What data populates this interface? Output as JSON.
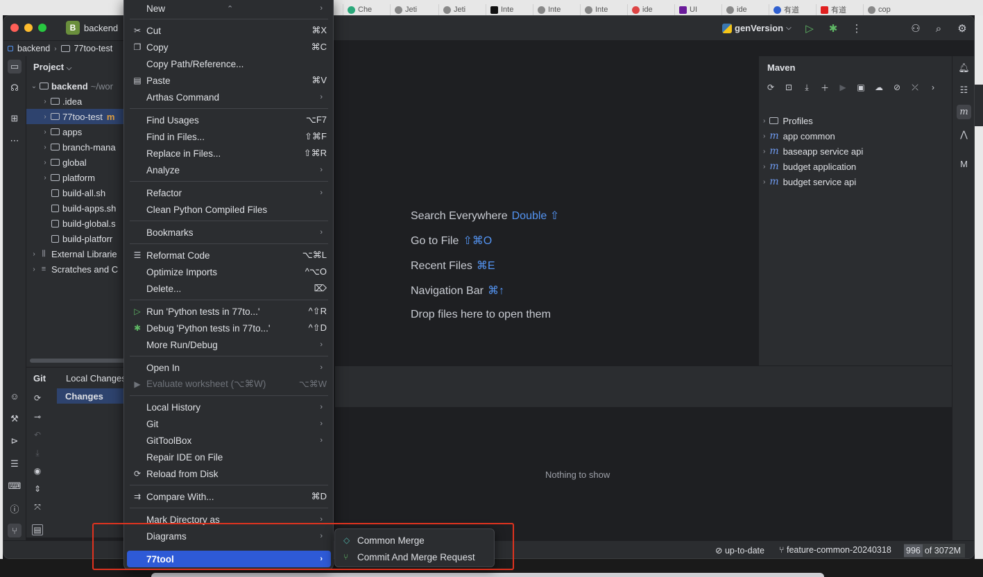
{
  "browser_tabs": [
    "Che",
    "Jeti",
    "Jeti",
    "Inte",
    "Inte",
    "Inte",
    "ide",
    "UI",
    "ide",
    "有道",
    "有道",
    "cop"
  ],
  "window": {
    "project_badge": "B",
    "project_name": "backend",
    "run_config": "genVersion"
  },
  "breadcrumb": {
    "root": "backend",
    "child": "77too-test"
  },
  "project_panel": {
    "title": "Project",
    "root_label": "backend",
    "root_path": "~/wor",
    "items": [
      ".idea",
      "77too-test",
      "apps",
      "branch-mana",
      "global",
      "platform",
      "build-all.sh",
      "build-apps.sh",
      "build-global.s",
      "build-platforr"
    ],
    "selected_suffix": "m",
    "external_libraries": "External Librarie",
    "scratches": "Scratches and C"
  },
  "git_panel": {
    "tab_git": "Git",
    "tab_local_changes": "Local Changes",
    "changes_node": "Changes"
  },
  "editor": {
    "hints": [
      {
        "text": "Search Everywhere",
        "key": "Double ⇧"
      },
      {
        "text": "Go to File",
        "key": "⇧⌘O"
      },
      {
        "text": "Recent Files",
        "key": "⌘E"
      },
      {
        "text": "Navigation Bar",
        "key": "⌘↑"
      },
      {
        "text": "Drop files here to open them",
        "key": ""
      }
    ]
  },
  "maven": {
    "title": "Maven",
    "profiles": "Profiles",
    "modules": [
      "app common",
      "baseapp service api",
      "budget application",
      "budget service api"
    ]
  },
  "bottom_panel": {
    "empty_text": "Nothing to show"
  },
  "statusbar": {
    "vcs_status": "up-to-date",
    "branch": "feature-common-20240318",
    "memory_used": "996",
    "memory_total": "of 3072M"
  },
  "context_menu": {
    "new": "New",
    "cut": {
      "label": "Cut",
      "shortcut": "⌘X"
    },
    "copy": {
      "label": "Copy",
      "shortcut": "⌘C"
    },
    "copy_path": "Copy Path/Reference...",
    "paste": {
      "label": "Paste",
      "shortcut": "⌘V"
    },
    "arthas": "Arthas Command",
    "find_usages": {
      "label": "Find Usages",
      "shortcut": "⌥F7"
    },
    "find_in_files": {
      "label": "Find in Files...",
      "shortcut": "⇧⌘F"
    },
    "replace_in_files": {
      "label": "Replace in Files...",
      "shortcut": "⇧⌘R"
    },
    "analyze": "Analyze",
    "refactor": "Refactor",
    "clean_python": "Clean Python Compiled Files",
    "bookmarks": "Bookmarks",
    "reformat": {
      "label": "Reformat Code",
      "shortcut": "⌥⌘L"
    },
    "optimize": {
      "label": "Optimize Imports",
      "shortcut": "^⌥O"
    },
    "delete": {
      "label": "Delete...",
      "shortcut": "⌦"
    },
    "run_tests": {
      "label": "Run 'Python tests in 77to...'",
      "shortcut": "^⇧R"
    },
    "debug_tests": {
      "label": "Debug 'Python tests in 77to...'",
      "shortcut": "^⇧D"
    },
    "more_run": "More Run/Debug",
    "open_in": "Open In",
    "evaluate": {
      "label": "Evaluate worksheet (⌥⌘W)",
      "shortcut": "⌥⌘W"
    },
    "local_history": "Local History",
    "git": "Git",
    "gittoolbox": "GitToolBox",
    "repair": "Repair IDE on File",
    "reload": "Reload from Disk",
    "compare": {
      "label": "Compare With...",
      "shortcut": "⌘D"
    },
    "mark_directory": "Mark Directory as",
    "diagrams": "Diagrams",
    "tool77": "77tool"
  },
  "submenu": {
    "common_merge": "Common Merge",
    "commit_merge": "Commit And Merge Request"
  },
  "colors": {
    "accent": "#2e5ad6",
    "selection": "#2e436e",
    "annotation_box": "#e0331f",
    "link_key": "#5495f4"
  }
}
